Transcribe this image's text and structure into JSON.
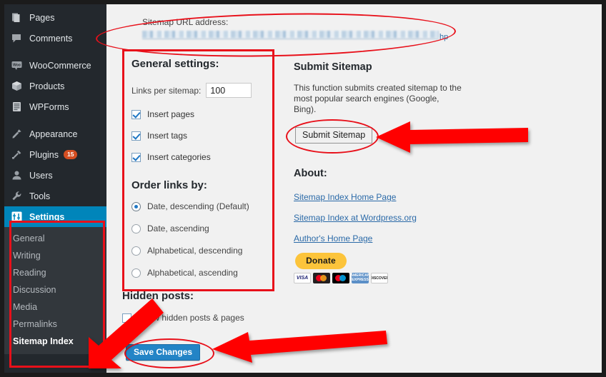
{
  "sidebar": {
    "items": [
      {
        "label": "Pages",
        "icon": "pages-icon"
      },
      {
        "label": "Comments",
        "icon": "comments-icon"
      },
      {
        "label": "WooCommerce",
        "icon": "woocommerce-icon"
      },
      {
        "label": "Products",
        "icon": "products-icon"
      },
      {
        "label": "WPForms",
        "icon": "wpforms-icon"
      },
      {
        "label": "Appearance",
        "icon": "appearance-icon"
      },
      {
        "label": "Plugins",
        "icon": "plugins-icon",
        "badge": "15"
      },
      {
        "label": "Users",
        "icon": "users-icon"
      },
      {
        "label": "Tools",
        "icon": "tools-icon"
      },
      {
        "label": "Settings",
        "icon": "settings-icon",
        "active": true
      }
    ],
    "submenu": [
      {
        "label": "General"
      },
      {
        "label": "Writing"
      },
      {
        "label": "Reading"
      },
      {
        "label": "Discussion"
      },
      {
        "label": "Media"
      },
      {
        "label": "Permalinks"
      },
      {
        "label": "Sitemap Index",
        "current": true
      }
    ]
  },
  "url_block": {
    "label": "Sitemap URL address:",
    "value_redacted": "",
    "visible_tail": "hp"
  },
  "general_settings": {
    "title": "General settings:",
    "links_per_sitemap_label": "Links per sitemap:",
    "links_per_sitemap_value": "100",
    "links_per_sitemap_placeholder": "100",
    "checkboxes": [
      {
        "label": "Insert pages",
        "checked": true
      },
      {
        "label": "Insert tags",
        "checked": true
      },
      {
        "label": "Insert categories",
        "checked": true
      }
    ],
    "order_title": "Order links by:",
    "radios": [
      {
        "label": "Date, descending (Default)",
        "selected": true
      },
      {
        "label": "Date, ascending",
        "selected": false
      },
      {
        "label": "Alphabetical, descending",
        "selected": false
      },
      {
        "label": "Alphabetical, ascending",
        "selected": false
      }
    ]
  },
  "hidden_posts": {
    "title": "Hidden posts:",
    "checkbox_label": "Show hidden posts & pages",
    "checked": false
  },
  "save_button_label": "Save Changes",
  "submit_sitemap": {
    "title": "Submit Sitemap",
    "description": "This function submits created sitemap to the most popular search engines (Google, Bing).",
    "button_label": "Submit Sitemap"
  },
  "about": {
    "title": "About:",
    "links": [
      {
        "label": "Sitemap Index Home Page"
      },
      {
        "label": "Sitemap Index at Wordpress.org"
      },
      {
        "label": "Author's Home Page"
      }
    ],
    "donate_label": "Donate",
    "cards": [
      {
        "name": "visa",
        "label": "VISA"
      },
      {
        "name": "mastercard",
        "label": ""
      },
      {
        "name": "maestro",
        "label": ""
      },
      {
        "name": "amex",
        "label": "AMERICAN EXPRESS"
      },
      {
        "name": "discover",
        "label": "DISCOVER"
      }
    ]
  },
  "colors": {
    "annotation_red": "#e8101a",
    "wp_sidebar": "#23282d",
    "wp_submenu": "#32373c",
    "wp_active_blue": "#0085ba",
    "primary_button_blue": "#2384c6",
    "link_blue": "#2b6aa8",
    "donate_yellow": "#fcc43b",
    "badge_orange": "#d54e21"
  }
}
